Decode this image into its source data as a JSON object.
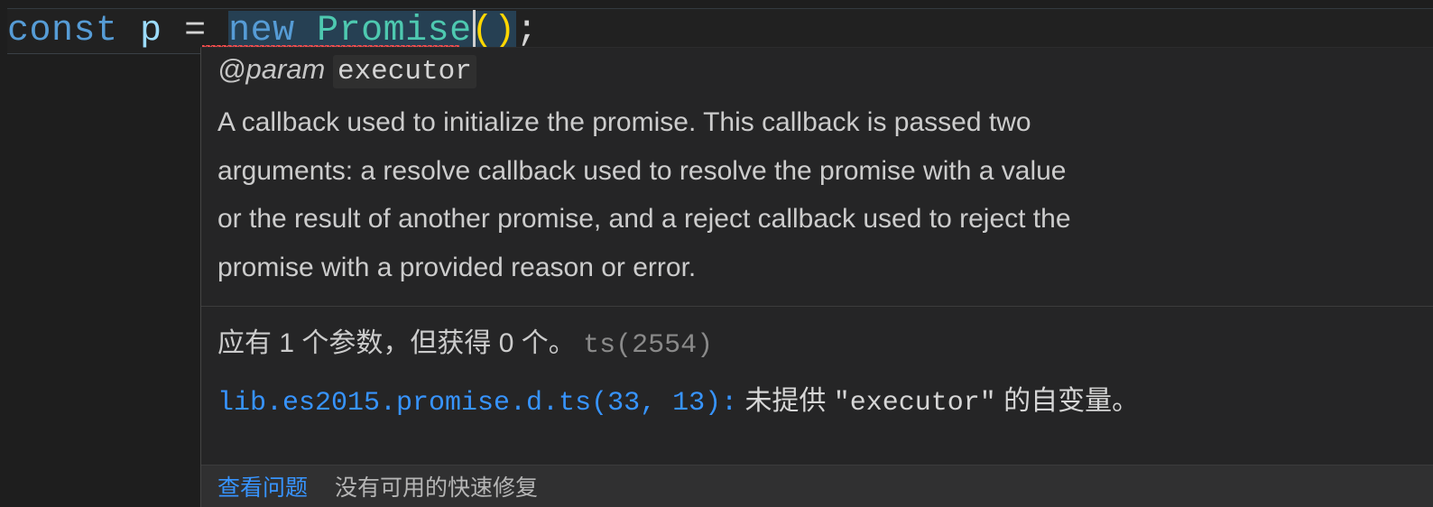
{
  "editor": {
    "code_line": {
      "tokens": [
        {
          "text": "const",
          "kind": "keyword"
        },
        {
          "text": " ",
          "kind": "plain"
        },
        {
          "text": "p",
          "kind": "variable"
        },
        {
          "text": " ",
          "kind": "plain"
        },
        {
          "text": "=",
          "kind": "operator"
        },
        {
          "text": " ",
          "kind": "plain"
        },
        {
          "text": "new",
          "kind": "keyword"
        },
        {
          "text": " ",
          "kind": "plain"
        },
        {
          "text": "Promise",
          "kind": "class"
        },
        {
          "text": "()",
          "kind": "paren"
        },
        {
          "text": ";",
          "kind": "semicolon"
        }
      ],
      "plain_text": "const p = new Promise();",
      "keyword": "const",
      "variable": "p",
      "operator": "=",
      "new_keyword": "new",
      "class_name": "Promise",
      "parens": "()",
      "semicolon": ";"
    }
  },
  "hover": {
    "param": {
      "tag": "@param",
      "name": "executor",
      "description": "A callback used to initialize the promise. This callback is passed two arguments: a resolve callback used to resolve the promise with a value or the result of another promise, and a reject callback used to reject the promise with a provided reason or error."
    },
    "diagnostics": [
      {
        "message": "应有 1 个参数，但获得 0 个。",
        "code": "ts(2554)"
      },
      {
        "link": "lib.es2015.promise.d.ts(33, 13):",
        "prefix": "未提供",
        "quoted": "\"executor\"",
        "suffix": "的自变量。"
      }
    ],
    "statusbar": {
      "view_problem_link": "查看问题",
      "no_quickfix_text": "没有可用的快速修复"
    }
  },
  "colors": {
    "editor_background": "#1e1e1e",
    "hover_background": "#252526",
    "hover_statusbar_background": "#303031",
    "keyword_blue": "#569cd6",
    "variable_blue": "#9cdcfe",
    "class_teal": "#4ec9b0",
    "paren_yellow": "#ffd700",
    "text_default": "#d4d4d4",
    "link_blue": "#3794ff",
    "error_squiggle": "#f14c4c",
    "selection_background": "#264053",
    "border": "#454545",
    "divider": "#3c3c3c",
    "dim_text": "#8a8a8a"
  }
}
